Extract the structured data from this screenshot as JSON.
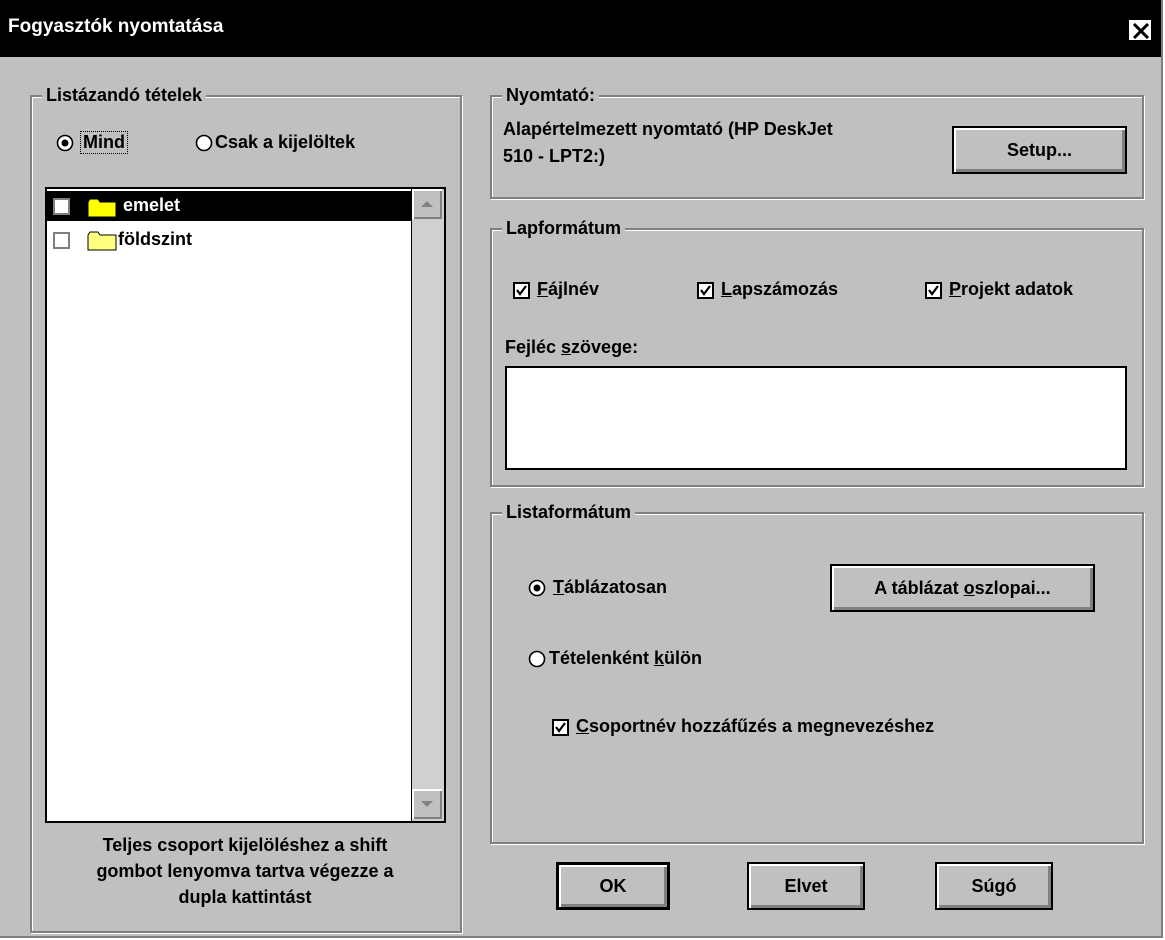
{
  "window": {
    "title": "Fogyasztók nyomtatása"
  },
  "items_group": {
    "legend": "Listázandó tételek",
    "radio_all": "Mind",
    "radio_selected": "Csak a kijelöltek",
    "selected_option": "Mind",
    "tree": [
      {
        "label": "emelet",
        "checked": false,
        "selected": true,
        "icon": "folder-icon"
      },
      {
        "label": "földszint",
        "checked": false,
        "selected": false,
        "icon": "folder-icon"
      }
    ],
    "hint_lines": [
      "Teljes csoport kijelöléshez a shift",
      "gombot lenyomva tartva végezze a",
      "dupla kattintást"
    ]
  },
  "printer_group": {
    "legend": "Nyomtató:",
    "printer_line1": "Alapértelmezett nyomtató (HP DeskJet",
    "printer_line2": "510 - LPT2:)",
    "setup_button": "Setup..."
  },
  "page_format_group": {
    "legend": "Lapformátum",
    "filename_label": "Fájlnév",
    "filename_checked": true,
    "page_numbering_label": "Lapszámozás",
    "page_numbering_checked": true,
    "project_data_label": "Projekt adatok",
    "project_data_checked": true,
    "header_text_label": "Fejléc szövege:",
    "header_text_value": ""
  },
  "list_format_group": {
    "legend": "Listaformátum",
    "tabular_label": "Táblázatosan",
    "per_item_label": "Tételenként külön",
    "selected_option": "Táblázatosan",
    "table_columns_button": "A táblázat oszlopai...",
    "append_group_label": "Csoportnév hozzáfűzés a megnevezéshez",
    "append_group_checked": true
  },
  "buttons": {
    "ok": "OK",
    "cancel": "Elvet",
    "help": "Súgó"
  }
}
